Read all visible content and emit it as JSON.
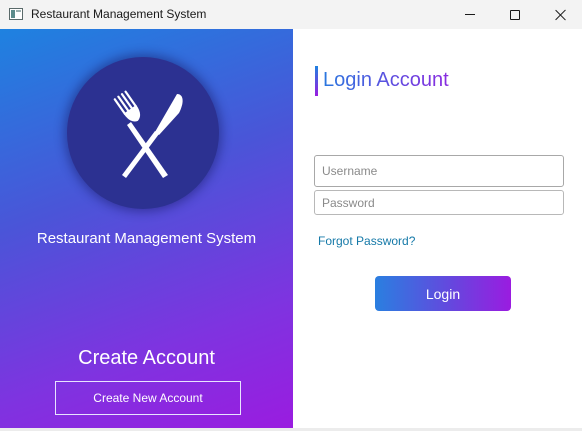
{
  "window": {
    "title": "Restaurant Management System"
  },
  "left_panel": {
    "logo_icon": "fork-knife-icon",
    "title": "Restaurant Management System",
    "create_heading": "Create Account",
    "create_button_label": "Create New Account"
  },
  "login": {
    "heading": "Login Account",
    "username_placeholder": "Username",
    "password_placeholder": "Password",
    "username_value": "",
    "password_value": "",
    "forgot_label": "Forgot Password?",
    "login_button_label": "Login"
  },
  "colors": {
    "gradient_start": "#1e82e0",
    "gradient_end": "#9a1ce0",
    "logo_circle": "#2c3191",
    "link": "#1579a8"
  }
}
